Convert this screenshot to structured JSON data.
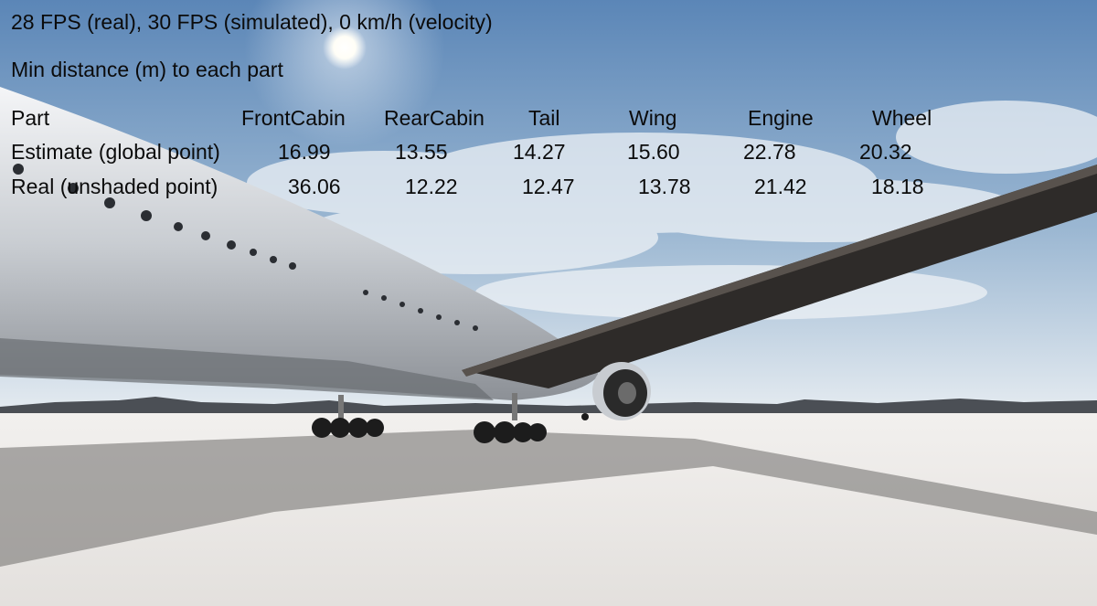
{
  "hud": {
    "status": "28 FPS (real), 30 FPS (simulated),  0 km/h (velocity)",
    "subtitle": "Min distance (m) to each part"
  },
  "table": {
    "header": [
      "Part",
      "FrontCabin",
      "RearCabin",
      "Tail",
      "Wing",
      "Engine",
      "Wheel"
    ],
    "rows": [
      [
        "Estimate (global point)",
        "16.99",
        "13.55",
        "14.27",
        "15.60",
        "22.78",
        "20.32"
      ],
      [
        "Real (unshaded point)",
        "36.06",
        "12.22",
        "12.47",
        "13.78",
        "21.42",
        "18.18"
      ]
    ]
  },
  "scene": {
    "subject": "airplane-on-salt-flat",
    "colors": {
      "sky_top": "#5d88b8",
      "sky_horizon": "#d9e2ea",
      "ground": "#e9e6e3",
      "fuselage": "#cfd3d8",
      "wing": "#2b2826"
    }
  }
}
